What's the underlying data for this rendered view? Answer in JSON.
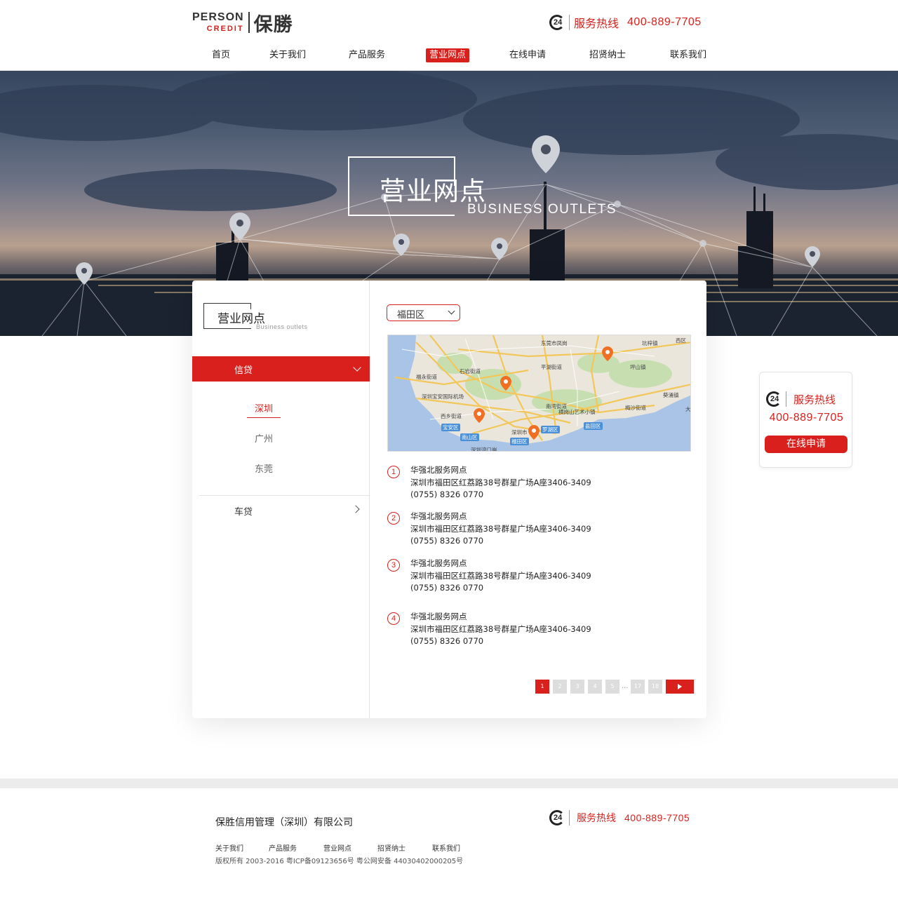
{
  "header": {
    "logo_en_line1": "PERSON",
    "logo_en_line2": "CREDIT",
    "logo_cn": "保勝",
    "hotline_badge": "24",
    "hotline_label": "服务热线",
    "hotline_number": "400-889-7705"
  },
  "nav": {
    "items": [
      {
        "label": "首页"
      },
      {
        "label": "关于我们"
      },
      {
        "label": "产品服务"
      },
      {
        "label": "营业网点"
      },
      {
        "label": "在线申请"
      },
      {
        "label": "招贤纳士"
      },
      {
        "label": "联系我们"
      }
    ],
    "active_index": 3
  },
  "banner": {
    "title": "营业网点",
    "subtitle": "BUSINESS OUTLETS"
  },
  "sidebar": {
    "title": "营业网点",
    "subtitle": "Business outlets",
    "menu": [
      {
        "label": "信贷",
        "expanded": true,
        "children": [
          {
            "label": "深圳"
          },
          {
            "label": "广州"
          },
          {
            "label": "东莞"
          }
        ]
      },
      {
        "label": "车贷",
        "expanded": false
      }
    ],
    "active_child": "深圳"
  },
  "district_select": {
    "value": "福田区"
  },
  "map": {
    "labels": [
      "东莞市凤岗",
      "坑梓镇",
      "西区",
      "石岩街道",
      "平湖街道",
      "坪山镇",
      "福永街道",
      "葵涌镇",
      "深圳宝安国际机场",
      "南湾街道",
      "梅沙街道",
      "横岗山艺术小镇",
      "西乡街道",
      "盐田区",
      "宝安区",
      "深圳市",
      "罗湖区",
      "南山区",
      "福田区",
      "深圳湾口岸",
      "大"
    ],
    "tags": [
      "宝安区",
      "罗湖区",
      "南山区",
      "福田区",
      "盐田区"
    ]
  },
  "outlets": [
    {
      "num": "1",
      "name": "华强北服务网点",
      "address": "深圳市福田区红荔路38号群星广场A座3406-3409",
      "phone": "(0755) 8326 0770"
    },
    {
      "num": "2",
      "name": "华强北服务网点",
      "address": "深圳市福田区红荔路38号群星广场A座3406-3409",
      "phone": "(0755) 8326 0770"
    },
    {
      "num": "3",
      "name": "华强北服务网点",
      "address": "深圳市福田区红荔路38号群星广场A座3406-3409",
      "phone": "(0755) 8326 0770"
    },
    {
      "num": "4",
      "name": "华强北服务网点",
      "address": "深圳市福田区红荔路38号群星广场A座3406-3409",
      "phone": "(0755) 8326 0770"
    }
  ],
  "pagination": {
    "pages": [
      "1",
      "2",
      "3",
      "4",
      "5"
    ],
    "ellipsis": "...",
    "last_pages": [
      "17",
      "18"
    ],
    "current": "1"
  },
  "float_panel": {
    "badge": "24",
    "label": "服务热线",
    "number": "400-889-7705",
    "apply_label": "在线申请"
  },
  "footer": {
    "company": "保胜信用管理（深圳）有限公司",
    "hotline_badge": "24",
    "hotline_label": "服务热线",
    "hotline_number": "400-889-7705",
    "links": [
      {
        "label": "关于我们"
      },
      {
        "label": "产品服务"
      },
      {
        "label": "营业网点"
      },
      {
        "label": "招贤纳士"
      },
      {
        "label": "联系我们"
      }
    ],
    "copyright": "版权所有 2003-2016 粤ICP备09123656号 粤公网安备 44030402000205号"
  },
  "colors": {
    "brand_red": "#d9201c",
    "text_dark": "#222222",
    "divider": "#e4e4e4"
  }
}
